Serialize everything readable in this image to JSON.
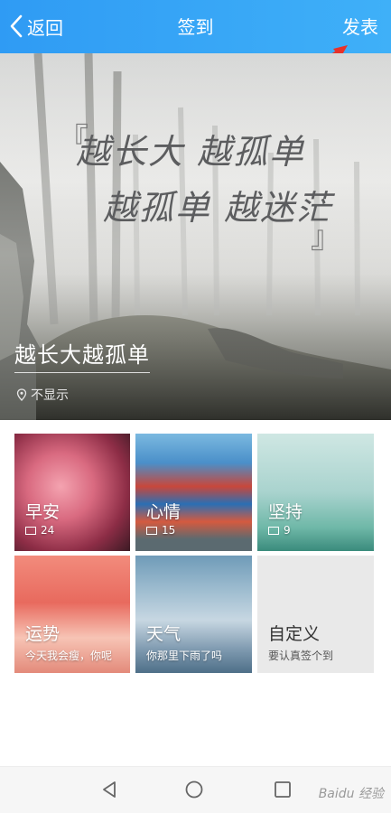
{
  "header": {
    "back_label": "返回",
    "title": "签到",
    "publish_label": "发表"
  },
  "hero": {
    "quote_line1": "越长大 越孤单",
    "quote_line2": "越孤单 越迷茫",
    "quote_open": "『",
    "quote_close": "』",
    "title": "越长大越孤单",
    "location": "不显示"
  },
  "cards": [
    {
      "name": "早安",
      "count": "24"
    },
    {
      "name": "心情",
      "count": "15"
    },
    {
      "name": "坚持",
      "count": "9"
    },
    {
      "name": "运势",
      "sub": "今天我会瘦，你呢"
    },
    {
      "name": "天气",
      "sub": "你那里下雨了吗"
    },
    {
      "name": "自定义",
      "sub": "要认真签个到"
    }
  ],
  "watermark": "Baidu 经验",
  "colors": {
    "header": "#3aa6f6",
    "annotation_arrow": "#e8312a"
  },
  "icons": {
    "back": "chevron-left-icon",
    "location": "location-pin-icon",
    "image_count": "image-icon",
    "nav_back": "triangle-back-icon",
    "nav_home": "circle-home-icon",
    "nav_recent": "square-recent-icon"
  }
}
